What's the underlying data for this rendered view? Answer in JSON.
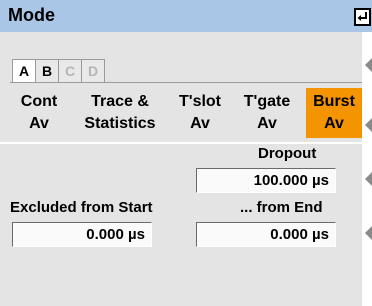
{
  "header": {
    "title": "Mode",
    "enter_icon": "enter-return-icon"
  },
  "tabs": [
    {
      "label": "A",
      "state": "selected"
    },
    {
      "label": "B",
      "state": "enabled"
    },
    {
      "label": "C",
      "state": "disabled"
    },
    {
      "label": "D",
      "state": "disabled"
    }
  ],
  "modes": [
    {
      "line1": "Cont",
      "line2": "Av",
      "active": false
    },
    {
      "line1": "Trace &",
      "line2": "Statistics",
      "active": false
    },
    {
      "line1": "T'slot",
      "line2": "Av",
      "active": false
    },
    {
      "line1": "T'gate",
      "line2": "Av",
      "active": false
    },
    {
      "line1": "Burst",
      "line2": "Av",
      "active": true
    }
  ],
  "dropout": {
    "label": "Dropout",
    "value": "100.000 µs"
  },
  "excluded_start": {
    "label": "Excluded from Start",
    "value": "0.000 µs"
  },
  "excluded_end": {
    "label": "... from End",
    "value": "0.000 µs"
  },
  "colors": {
    "titlebar": "#a9c6e7",
    "active_mode": "#f39400",
    "panel": "#e4e4e4"
  }
}
